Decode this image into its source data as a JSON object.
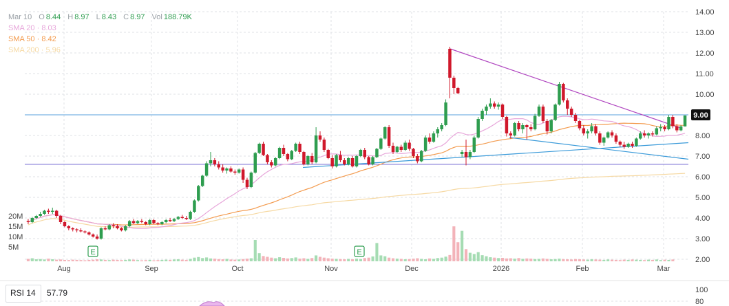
{
  "legend": {
    "date": "Mar 10",
    "open_label": "O",
    "open": "8.44",
    "high_label": "H",
    "high": "8.97",
    "low_label": "L",
    "low": "8.43",
    "close_label": "C",
    "close": "8.97",
    "vol_label": "Vol",
    "vol": "188.79K",
    "sma20_label": "SMA 20",
    "sma20": "8.03",
    "sma50_label": "SMA 50",
    "sma50": "8.42",
    "sma200_label": "SMA 200",
    "sma200": "5.96",
    "separator": "·"
  },
  "rsi": {
    "label": "RSI 14",
    "value": "57.79",
    "ticks": [
      "100",
      "80"
    ]
  },
  "colors": {
    "up": "#2e9d4f",
    "down": "#d0182b",
    "sma20": "#e7a6da",
    "sma50": "#f39a4d",
    "sma200": "#f6d9a3",
    "hline": "#5aa2dd",
    "hline2": "#7b72d6",
    "trend_purple": "#b046c0",
    "trend_blue": "#3a9ad9",
    "earnings": "#2e9d4f"
  },
  "chart_data": {
    "type": "candlestick",
    "price_axis": {
      "ylim": [
        2,
        14
      ],
      "ticks": [
        "14.00",
        "13.00",
        "12.00",
        "11.00",
        "10.00",
        "9.00",
        "8.00",
        "7.00",
        "6.00",
        "5.00",
        "4.00",
        "3.00",
        "2.00"
      ]
    },
    "volume_axis": {
      "ticks": [
        "20M",
        "15M",
        "10M",
        "5M"
      ],
      "max": 22
    },
    "x_labels": [
      "Aug",
      "Sep",
      "Oct",
      "Nov",
      "Dec",
      "2026",
      "Feb",
      "Mar"
    ],
    "last_price_label": "9.00",
    "horizontal_levels": [
      9.0,
      6.6
    ],
    "earnings_marker": "E",
    "candles": [
      [
        3.85,
        3.95,
        3.7,
        3.8
      ],
      [
        3.8,
        4.05,
        3.75,
        4.0
      ],
      [
        4.0,
        4.15,
        3.95,
        4.1
      ],
      [
        4.1,
        4.3,
        4.05,
        4.2
      ],
      [
        4.2,
        4.4,
        4.15,
        4.35
      ],
      [
        4.35,
        4.45,
        4.2,
        4.3
      ],
      [
        4.3,
        4.5,
        4.2,
        4.35
      ],
      [
        4.35,
        4.4,
        4.0,
        4.1
      ],
      [
        4.1,
        4.15,
        3.7,
        3.8
      ],
      [
        3.8,
        3.85,
        3.55,
        3.6
      ],
      [
        3.6,
        3.65,
        3.4,
        3.5
      ],
      [
        3.5,
        3.55,
        3.35,
        3.45
      ],
      [
        3.45,
        3.5,
        3.3,
        3.4
      ],
      [
        3.4,
        3.5,
        3.3,
        3.35
      ],
      [
        3.35,
        3.4,
        3.25,
        3.3
      ],
      [
        3.3,
        3.35,
        3.15,
        3.2
      ],
      [
        3.2,
        3.25,
        3.05,
        3.1
      ],
      [
        3.1,
        3.2,
        2.95,
        3.0
      ],
      [
        3.0,
        3.55,
        2.95,
        3.5
      ],
      [
        3.5,
        3.6,
        3.4,
        3.45
      ],
      [
        3.45,
        3.7,
        3.4,
        3.65
      ],
      [
        3.65,
        3.75,
        3.5,
        3.6
      ],
      [
        3.6,
        3.7,
        3.45,
        3.5
      ],
      [
        3.5,
        3.55,
        3.35,
        3.4
      ],
      [
        3.4,
        3.65,
        3.35,
        3.6
      ],
      [
        3.6,
        3.9,
        3.55,
        3.85
      ],
      [
        3.85,
        3.95,
        3.7,
        3.75
      ],
      [
        3.75,
        3.9,
        3.7,
        3.85
      ],
      [
        3.85,
        3.95,
        3.75,
        3.8
      ],
      [
        3.8,
        3.85,
        3.65,
        3.7
      ],
      [
        3.7,
        3.95,
        3.65,
        3.9
      ],
      [
        3.9,
        3.95,
        3.7,
        3.75
      ],
      [
        3.75,
        3.8,
        3.65,
        3.7
      ],
      [
        3.7,
        3.85,
        3.65,
        3.8
      ],
      [
        3.8,
        3.95,
        3.75,
        3.9
      ],
      [
        3.9,
        4.0,
        3.8,
        3.85
      ],
      [
        3.85,
        4.0,
        3.8,
        3.95
      ],
      [
        3.95,
        4.1,
        3.9,
        4.05
      ],
      [
        4.05,
        4.15,
        3.95,
        4.0
      ],
      [
        4.0,
        4.1,
        3.9,
        3.95
      ],
      [
        3.95,
        4.35,
        3.9,
        4.3
      ],
      [
        4.3,
        4.9,
        4.25,
        4.85
      ],
      [
        4.85,
        5.6,
        4.8,
        5.55
      ],
      [
        5.55,
        6.1,
        5.5,
        6.05
      ],
      [
        6.05,
        6.75,
        6.0,
        6.65
      ],
      [
        6.65,
        7.2,
        6.5,
        6.8
      ],
      [
        6.8,
        6.9,
        6.5,
        6.6
      ],
      [
        6.6,
        6.75,
        6.35,
        6.45
      ],
      [
        6.45,
        6.6,
        6.2,
        6.3
      ],
      [
        6.3,
        6.45,
        6.15,
        6.4
      ],
      [
        6.4,
        6.5,
        6.2,
        6.25
      ],
      [
        6.25,
        6.35,
        6.1,
        6.2
      ],
      [
        6.2,
        6.4,
        6.15,
        6.35
      ],
      [
        6.35,
        6.45,
        5.7,
        5.85
      ],
      [
        5.85,
        5.95,
        5.4,
        5.5
      ],
      [
        5.5,
        6.25,
        5.45,
        6.2
      ],
      [
        6.2,
        7.2,
        6.15,
        7.15
      ],
      [
        7.15,
        7.65,
        7.1,
        7.6
      ],
      [
        7.6,
        7.7,
        7.0,
        7.05
      ],
      [
        7.05,
        7.1,
        6.6,
        6.7
      ],
      [
        6.7,
        6.8,
        6.45,
        6.55
      ],
      [
        6.55,
        6.95,
        6.5,
        6.9
      ],
      [
        6.9,
        7.45,
        6.85,
        7.4
      ],
      [
        7.4,
        7.55,
        7.0,
        7.1
      ],
      [
        7.1,
        7.15,
        6.75,
        6.85
      ],
      [
        6.85,
        7.3,
        6.8,
        7.25
      ],
      [
        7.25,
        7.65,
        7.2,
        7.6
      ],
      [
        7.6,
        7.7,
        7.1,
        7.2
      ],
      [
        7.2,
        7.25,
        6.55,
        6.6
      ],
      [
        6.6,
        7.05,
        6.55,
        7.0
      ],
      [
        7.0,
        7.15,
        6.6,
        6.7
      ],
      [
        6.7,
        8.4,
        6.65,
        8.0
      ],
      [
        8.0,
        8.2,
        7.7,
        7.8
      ],
      [
        7.8,
        7.9,
        7.2,
        7.3
      ],
      [
        7.3,
        7.35,
        6.85,
        6.9
      ],
      [
        6.9,
        7.05,
        6.4,
        6.5
      ],
      [
        6.5,
        7.1,
        6.45,
        7.05
      ],
      [
        7.05,
        7.25,
        6.7,
        6.8
      ],
      [
        6.8,
        6.9,
        6.55,
        6.6
      ],
      [
        6.6,
        6.95,
        6.55,
        6.9
      ],
      [
        6.9,
        7.0,
        6.45,
        6.5
      ],
      [
        6.5,
        7.05,
        6.45,
        7.0
      ],
      [
        7.0,
        7.35,
        6.95,
        7.3
      ],
      [
        7.3,
        7.4,
        6.85,
        6.95
      ],
      [
        6.95,
        7.0,
        6.55,
        6.6
      ],
      [
        6.6,
        7.0,
        6.55,
        6.95
      ],
      [
        6.95,
        7.4,
        6.9,
        7.35
      ],
      [
        7.35,
        7.9,
        7.3,
        7.85
      ],
      [
        7.85,
        8.45,
        7.8,
        8.4
      ],
      [
        8.4,
        8.5,
        7.4,
        7.5
      ],
      [
        7.5,
        7.65,
        7.1,
        7.2
      ],
      [
        7.2,
        7.5,
        7.15,
        7.45
      ],
      [
        7.45,
        7.55,
        7.2,
        7.3
      ],
      [
        7.3,
        7.75,
        7.25,
        7.65
      ],
      [
        7.65,
        7.8,
        7.25,
        7.35
      ],
      [
        7.35,
        7.4,
        6.9,
        7.0
      ],
      [
        7.0,
        7.1,
        6.65,
        6.75
      ],
      [
        6.75,
        7.3,
        6.7,
        7.25
      ],
      [
        7.25,
        8.0,
        7.2,
        7.9
      ],
      [
        7.9,
        8.1,
        7.6,
        7.7
      ],
      [
        7.7,
        8.2,
        7.65,
        8.1
      ],
      [
        8.1,
        8.4,
        7.9,
        8.3
      ],
      [
        8.3,
        8.6,
        8.2,
        8.5
      ],
      [
        8.5,
        9.75,
        8.45,
        9.6
      ],
      [
        12.2,
        12.3,
        9.8,
        10.8
      ],
      [
        10.8,
        10.9,
        10.0,
        10.3
      ],
      [
        10.3,
        10.35,
        10.0,
        10.05
      ],
      [
        7.1,
        7.3,
        6.95,
        7.2
      ],
      [
        7.2,
        7.8,
        6.55,
        6.95
      ],
      [
        6.95,
        7.3,
        6.85,
        7.2
      ],
      [
        7.2,
        8.0,
        7.15,
        7.9
      ],
      [
        7.9,
        8.9,
        7.85,
        8.8
      ],
      [
        8.8,
        9.3,
        8.7,
        9.2
      ],
      [
        9.2,
        9.5,
        9.0,
        9.4
      ],
      [
        9.4,
        9.8,
        9.3,
        9.55
      ],
      [
        9.55,
        9.65,
        9.3,
        9.4
      ],
      [
        9.4,
        9.6,
        9.25,
        9.5
      ],
      [
        9.5,
        9.55,
        8.8,
        8.9
      ],
      [
        8.9,
        8.95,
        7.95,
        8.1
      ],
      [
        8.1,
        8.2,
        7.85,
        8.0
      ],
      [
        8.0,
        8.65,
        7.95,
        8.6
      ],
      [
        8.6,
        8.7,
        8.2,
        8.3
      ],
      [
        8.3,
        8.6,
        8.1,
        8.5
      ],
      [
        8.5,
        8.55,
        7.8,
        8.4
      ],
      [
        8.4,
        8.55,
        8.2,
        8.3
      ],
      [
        8.3,
        9.05,
        8.25,
        8.95
      ],
      [
        8.95,
        9.5,
        8.9,
        9.4
      ],
      [
        9.4,
        9.5,
        8.6,
        8.7
      ],
      [
        8.7,
        8.8,
        8.05,
        8.2
      ],
      [
        8.2,
        8.8,
        8.1,
        8.75
      ],
      [
        8.75,
        9.55,
        8.7,
        9.5
      ],
      [
        9.5,
        10.6,
        9.45,
        10.5
      ],
      [
        10.5,
        10.55,
        9.6,
        9.7
      ],
      [
        9.7,
        9.8,
        9.0,
        9.3
      ],
      [
        9.3,
        9.4,
        8.9,
        9.0
      ],
      [
        9.0,
        9.1,
        8.6,
        8.7
      ],
      [
        8.7,
        8.75,
        8.25,
        8.35
      ],
      [
        8.35,
        8.5,
        8.0,
        8.1
      ],
      [
        8.1,
        8.3,
        7.85,
        8.2
      ],
      [
        8.2,
        8.6,
        8.1,
        8.45
      ],
      [
        8.45,
        8.55,
        8.0,
        8.1
      ],
      [
        8.1,
        8.2,
        7.55,
        7.65
      ],
      [
        7.65,
        7.95,
        7.5,
        7.9
      ],
      [
        7.9,
        8.2,
        7.85,
        8.15
      ],
      [
        8.15,
        8.25,
        7.9,
        8.0
      ],
      [
        8.0,
        8.1,
        7.6,
        7.7
      ],
      [
        7.7,
        7.75,
        7.45,
        7.55
      ],
      [
        7.55,
        7.7,
        7.35,
        7.45
      ],
      [
        7.45,
        7.65,
        7.4,
        7.6
      ],
      [
        7.6,
        7.7,
        7.4,
        7.5
      ],
      [
        7.5,
        7.9,
        7.45,
        7.85
      ],
      [
        7.85,
        8.2,
        7.8,
        8.1
      ],
      [
        8.1,
        8.25,
        7.9,
        8.0
      ],
      [
        8.0,
        8.15,
        7.85,
        8.1
      ],
      [
        8.1,
        8.2,
        7.95,
        8.05
      ],
      [
        8.05,
        8.45,
        8.0,
        8.35
      ],
      [
        8.35,
        8.55,
        8.2,
        8.4
      ],
      [
        8.4,
        8.5,
        8.2,
        8.3
      ],
      [
        8.3,
        9.0,
        8.25,
        8.9
      ],
      [
        8.9,
        9.0,
        8.35,
        8.45
      ],
      [
        8.45,
        8.55,
        8.15,
        8.25
      ],
      [
        8.25,
        8.5,
        8.2,
        8.44
      ],
      [
        8.44,
        8.97,
        8.43,
        8.97
      ]
    ],
    "volumes": [
      1.2,
      1.5,
      1.0,
      1.1,
      0.9,
      1.3,
      1.0,
      0.8,
      0.9,
      0.7,
      0.6,
      0.8,
      0.7,
      0.6,
      0.5,
      0.7,
      0.8,
      1.0,
      0.9,
      0.7,
      0.6,
      0.8,
      0.7,
      0.6,
      0.7,
      0.9,
      0.8,
      0.6,
      0.5,
      0.6,
      0.7,
      0.5,
      0.6,
      0.7,
      0.8,
      0.7,
      0.9,
      1.0,
      0.8,
      0.7,
      1.2,
      1.8,
      2.1,
      1.6,
      1.9,
      1.4,
      1.3,
      1.1,
      1.0,
      1.2,
      0.9,
      0.8,
      0.9,
      1.1,
      1.3,
      1.5,
      10.5,
      4.0,
      2.6,
      2.2,
      1.8,
      1.5,
      2.0,
      1.7,
      1.4,
      1.6,
      1.9,
      1.3,
      1.5,
      1.2,
      1.6,
      2.9,
      2.2,
      1.8,
      1.5,
      1.3,
      1.2,
      1.1,
      1.0,
      1.2,
      1.0,
      1.3,
      1.1,
      1.6,
      1.8,
      2.4,
      9.0,
      2.9,
      2.5,
      1.8,
      1.5,
      1.3,
      1.2,
      1.0,
      1.1,
      1.3,
      1.5,
      1.2,
      1.0,
      1.4,
      1.2,
      1.6,
      1.8,
      2.3,
      3.1,
      17.2,
      9.4,
      15.0,
      6.0,
      4.2,
      3.6,
      4.5,
      3.0,
      2.5,
      2.0,
      1.8,
      1.6,
      1.7,
      1.4,
      1.5,
      1.3,
      1.6,
      1.2,
      1.4,
      1.3,
      1.1,
      1.2,
      1.4,
      1.2,
      1.0,
      1.1,
      1.3,
      1.1,
      1.0,
      0.9,
      1.1,
      1.0,
      0.9,
      0.8,
      1.0,
      0.9,
      0.8,
      0.7,
      0.9,
      0.8,
      0.7,
      0.6,
      0.8,
      0.7,
      0.9,
      0.8,
      0.7,
      0.6,
      0.8,
      0.7,
      0.9,
      0.6,
      0.8,
      0.7,
      0.9
    ]
  }
}
